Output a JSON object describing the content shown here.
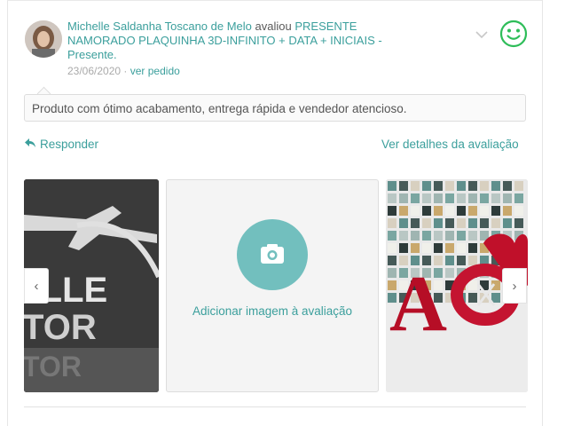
{
  "review": {
    "author": "Michelle Saldanha Toscano de Melo",
    "action": "avaliou",
    "product": "PRESENTE NAMORADO PLAQUINHA 3D-INFINITO + DATA + INICIAIS - Presente.",
    "date": "23/06/2020",
    "separator": "·",
    "order_link": "ver pedido",
    "comment": "Produto com ótimo acabamento, entrega rápida e vendedor atencioso.",
    "reply_label": "Responder",
    "details_link": "Ver detalhes da avaliação",
    "add_image_label": "Adicionar imagem à avaliação",
    "prev_arrow": "‹",
    "next_arrow": "›",
    "rating_icon": "smile-icon",
    "accent_color": "#3b9f9c",
    "smile_color": "#2ebd59"
  }
}
